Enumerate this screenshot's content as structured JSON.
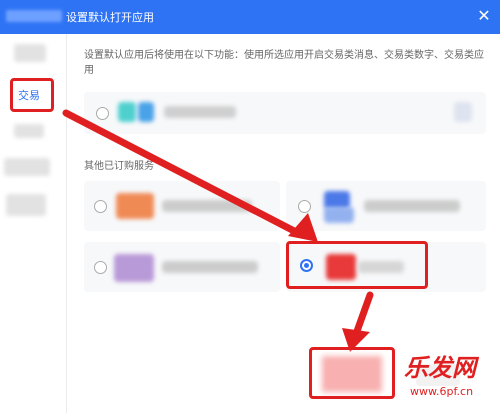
{
  "window": {
    "title": "设置默认打开应用",
    "close_glyph": "✕"
  },
  "sidebar": {
    "selected_item_label": "交易"
  },
  "main": {
    "description": "设置默认应用后将使用在以下功能：使用所选应用开启交易类消息、交易类数字、交易类应用",
    "other_section_label": "其他已订购服务"
  },
  "watermark": {
    "brand": "乐发网",
    "url": "www.6pf.cn"
  },
  "colors": {
    "accent": "#2f73f5",
    "highlight": "#e02020"
  }
}
